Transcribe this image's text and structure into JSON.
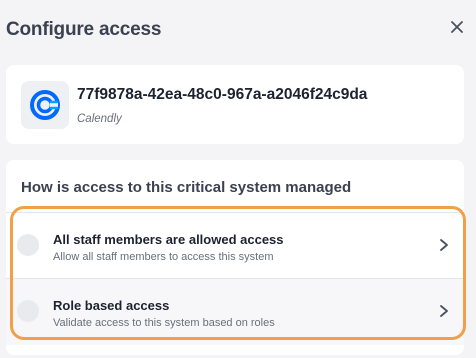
{
  "header": {
    "title": "Configure access",
    "close_icon": "close-icon"
  },
  "system": {
    "id": "77f9878a-42ea-48c0-967a-a2046f24c9da",
    "name": "Calendly",
    "logo_icon": "calendly-logo",
    "logo_color": "#0069ff"
  },
  "question": {
    "text": "How is access to this critical system managed"
  },
  "options": [
    {
      "title": "All staff members are allowed access",
      "description": "Allow all staff members to access this system"
    },
    {
      "title": "Role based access",
      "description": "Validate access to this system based on roles"
    }
  ],
  "colors": {
    "highlight": "#f0a048",
    "background": "#f4f4f6"
  }
}
